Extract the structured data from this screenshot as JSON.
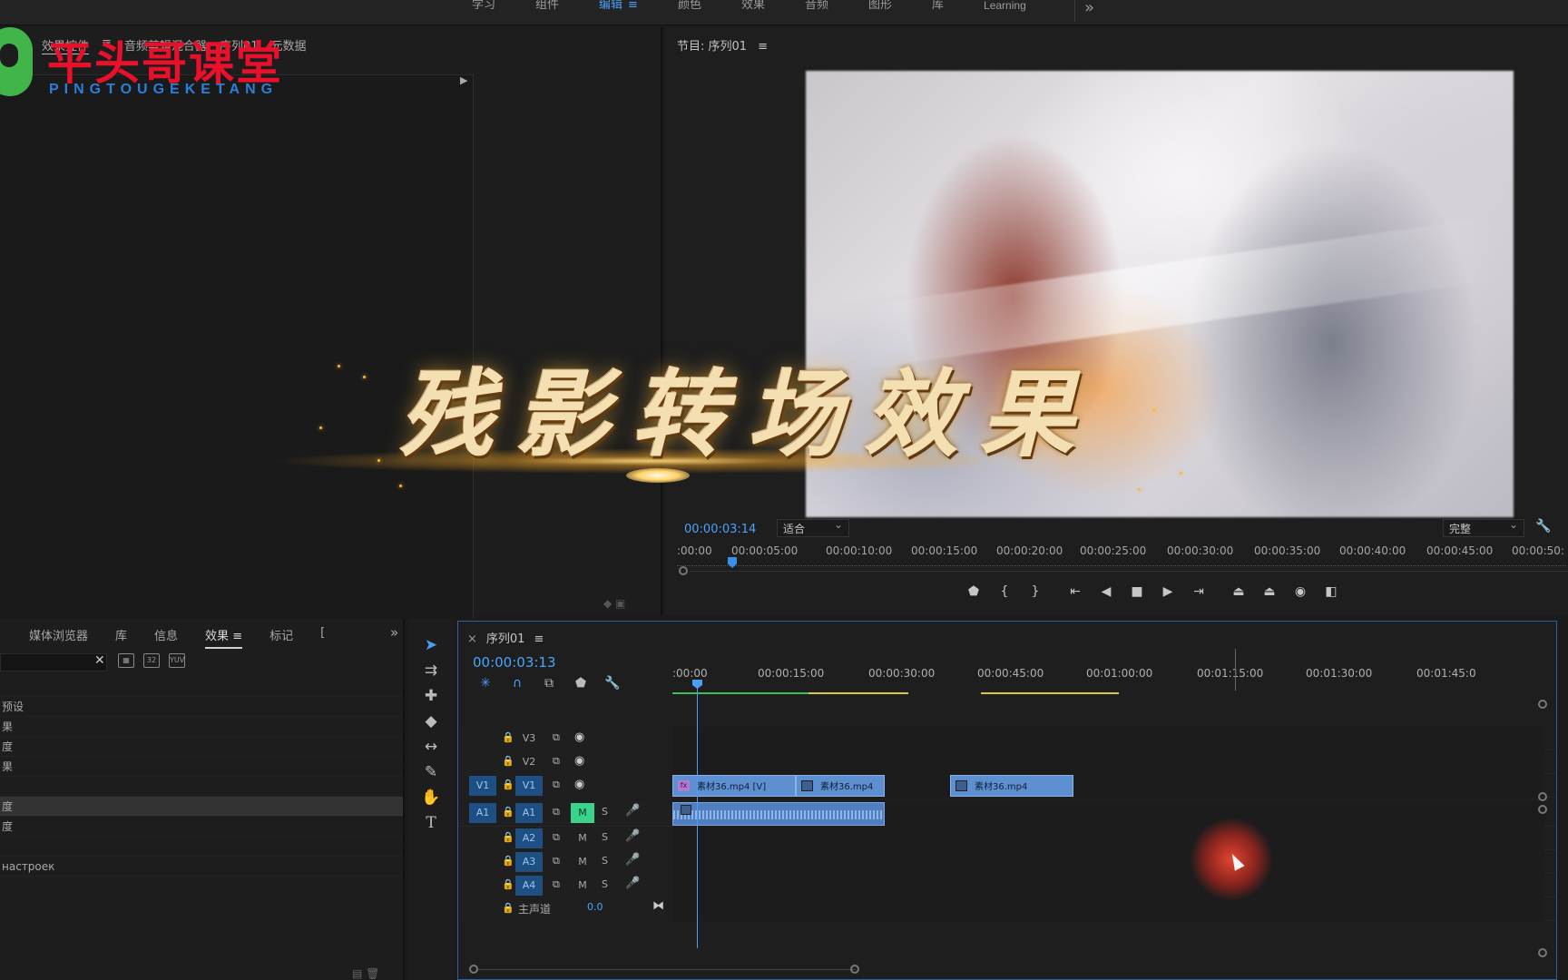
{
  "workspace_tabs": [
    {
      "label": "学习",
      "active": false
    },
    {
      "label": "组件",
      "active": false
    },
    {
      "label": "编辑",
      "active": true
    },
    {
      "label": "颜色",
      "active": false
    },
    {
      "label": "效果",
      "active": false
    },
    {
      "label": "音频",
      "active": false
    },
    {
      "label": "图形",
      "active": false
    },
    {
      "label": "库",
      "active": false
    },
    {
      "label": "Learning",
      "active": false
    }
  ],
  "workspace_menu": "≡",
  "workspace_more": "»",
  "logo": {
    "title": "平头哥课堂",
    "subtitle": "PINGTOUGEKETANG"
  },
  "effect_controls": {
    "tabs": [
      "效果控件",
      "≡",
      "音频剪辑混合器",
      "序列01",
      "元数据"
    ]
  },
  "program_monitor": {
    "title": "节目: 序列01",
    "menu": "≡",
    "timecode": "00:00:03:14",
    "fit": "适合",
    "quality": "完整",
    "ruler": [
      ":00:00",
      "00:00:05:00",
      "00:00:10:00",
      "00:00:15:00",
      "00:00:20:00",
      "00:00:25:00",
      "00:00:30:00",
      "00:00:35:00",
      "00:00:40:00",
      "00:00:45:00",
      "00:00:50:"
    ],
    "transport": [
      "marker-icon",
      "in-icon",
      "out-icon",
      "goto-in-icon",
      "step-back-icon",
      "stop-icon",
      "step-forward-icon",
      "goto-out-icon",
      "insert-icon",
      "overwrite-icon",
      "camera-icon",
      "compare-icon"
    ]
  },
  "overlay_title": "残影转场效果",
  "effects_panel": {
    "tabs": [
      {
        "label": "媒体浏览器",
        "active": false
      },
      {
        "label": "库",
        "active": false
      },
      {
        "label": "信息",
        "active": false
      },
      {
        "label": "效果",
        "active": true
      },
      {
        "label": "标记",
        "active": false
      },
      {
        "label": "[",
        "active": false
      }
    ],
    "more": "»",
    "search_value": "",
    "clear": "✕",
    "filter_icons": [
      "fx-accel-icon",
      "32-bit-icon",
      "yuv-icon"
    ],
    "filter_labels": [
      "▦",
      "32",
      "YUV"
    ],
    "rows": [
      {
        "label": "",
        "selected": false
      },
      {
        "label": "预设",
        "selected": false
      },
      {
        "label": "果",
        "selected": false
      },
      {
        "label": "度",
        "selected": false
      },
      {
        "label": "果",
        "selected": false
      },
      {
        "label": "",
        "selected": false
      },
      {
        "label": "度",
        "selected": true
      },
      {
        "label": "度",
        "selected": false
      },
      {
        "label": "",
        "selected": false
      },
      {
        "label": "настроек",
        "selected": false
      }
    ]
  },
  "tools": [
    "selection-tool",
    "track-select-tool",
    "ripple-edit-tool",
    "razor-tool",
    "slip-tool",
    "pen-tool",
    "hand-tool",
    "type-tool"
  ],
  "timeline": {
    "close": "×",
    "title": "序列01",
    "menu": "≡",
    "timecode": "00:00:03:13",
    "ruler": [
      ":00:00",
      "00:00:15:00",
      "00:00:30:00",
      "00:00:45:00",
      "00:01:00:00",
      "00:01:15:00",
      "00:01:30:00",
      "00:01:45:0"
    ],
    "video_tracks": [
      {
        "name": "V3",
        "source": "",
        "targeted": false
      },
      {
        "name": "V2",
        "source": "",
        "targeted": false
      },
      {
        "name": "V1",
        "source": "V1",
        "targeted": true
      }
    ],
    "audio_tracks": [
      {
        "name": "A1",
        "source": "A1",
        "targeted": true,
        "mute_on": true
      },
      {
        "name": "A2",
        "source": "",
        "targeted": true,
        "mute_on": false
      },
      {
        "name": "A3",
        "source": "",
        "targeted": true,
        "mute_on": false
      },
      {
        "name": "A4",
        "source": "",
        "targeted": true,
        "mute_on": false
      }
    ],
    "mute_label": "M",
    "solo_label": "S",
    "master_label": "主声道",
    "master_value": "0.0",
    "clips": [
      {
        "label": "素材36.mp4 [V]",
        "fx": "fx"
      },
      {
        "label": "素材36.mp4",
        "fx": ""
      },
      {
        "label": "素材36.mp4",
        "fx": ""
      }
    ]
  },
  "colors": {
    "accent": "#4a9ff5",
    "clip_video": "#5e8fd1",
    "clip_audio": "#4f7fc0",
    "mute_on": "#3ad38c",
    "logo_red": "#e8102a",
    "logo_blue": "#2a7fd8"
  }
}
